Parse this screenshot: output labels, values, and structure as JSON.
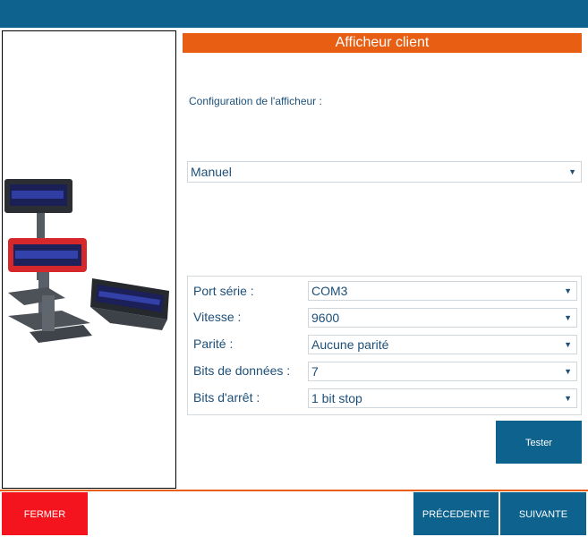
{
  "window": {
    "title": "Afficheur client"
  },
  "config": {
    "label": "Configuration de l'afficheur :",
    "mode": "Manuel"
  },
  "serial": {
    "rows": [
      {
        "label": "Port série :",
        "value": "COM3"
      },
      {
        "label": "Vitesse :",
        "value": "9600"
      },
      {
        "label": "Parité :",
        "value": "Aucune parité"
      },
      {
        "label": "Bits de données :",
        "value": "7"
      },
      {
        "label": "Bits d'arrêt :",
        "value": "1 bit stop"
      }
    ]
  },
  "buttons": {
    "test": "Tester",
    "close": "FERMER",
    "previous": "PRÉCEDENTE",
    "next": "SUIVANTE"
  },
  "colors": {
    "accent_blue": "#0e628e",
    "accent_orange": "#e85f14",
    "close_red": "#f4141e"
  },
  "icons": {
    "dropdown": "chevron-down-icon",
    "product_image": "customer-display-devices-image"
  }
}
